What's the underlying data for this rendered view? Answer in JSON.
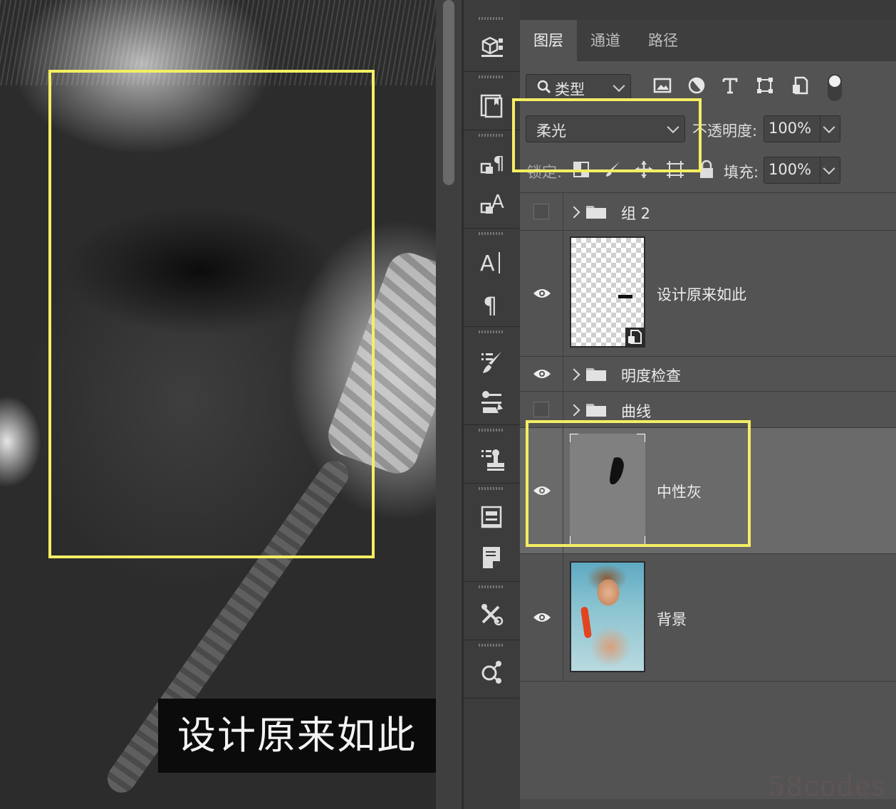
{
  "canvas": {
    "caption": "设计原来如此"
  },
  "panel": {
    "tabs": [
      {
        "label": "图层",
        "active": true
      },
      {
        "label": "通道",
        "active": false
      },
      {
        "label": "路径",
        "active": false
      }
    ],
    "filter": {
      "kind_label": "类型"
    },
    "blend_mode": "柔光",
    "opacity_label": "不透明度:",
    "opacity_value": "100%",
    "lock_label": "锁定:",
    "fill_label": "填充:",
    "fill_value": "100%",
    "layers": [
      {
        "name": "组 2",
        "type": "group",
        "visible": false
      },
      {
        "name": "设计原来如此",
        "type": "smart-object",
        "visible": true
      },
      {
        "name": "明度检查",
        "type": "group",
        "visible": true
      },
      {
        "name": "曲线",
        "type": "group",
        "visible": false
      },
      {
        "name": "中性灰",
        "type": "pixel",
        "visible": true,
        "selected": true
      },
      {
        "name": "背景",
        "type": "photo",
        "visible": true
      }
    ]
  },
  "watermark": "58codes",
  "colors": {
    "highlight": "#f4ee63",
    "panel_bg": "#535353",
    "selected_row": "#6a6a6a"
  }
}
